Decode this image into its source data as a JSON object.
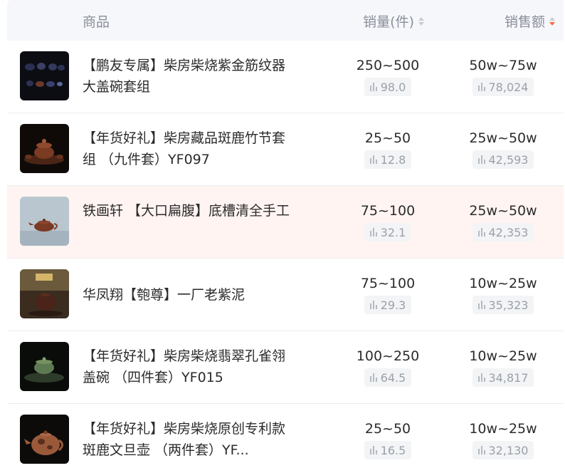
{
  "header": {
    "product": "商品",
    "sales_volume": "销量(件)",
    "sales_amount": "销售额"
  },
  "rows": [
    {
      "name": "【鹏友专属】柴房柴烧紫金筋纹器大盖碗套组",
      "sales_range": "250~500",
      "sales_index": "98.0",
      "amount_range": "50w~75w",
      "amount_index": "78,024",
      "highlight": false
    },
    {
      "name": "【年货好礼】柴房藏品斑鹿竹节套组 （九件套）YF097",
      "sales_range": "25~50",
      "sales_index": "12.8",
      "amount_range": "25w~50w",
      "amount_index": "42,593",
      "highlight": false
    },
    {
      "name": "铁画轩 【大口扁腹】底槽清全手工",
      "sales_range": "75~100",
      "sales_index": "32.1",
      "amount_range": "25w~50w",
      "amount_index": "42,353",
      "highlight": true
    },
    {
      "name": "华凤翔【匏尊】一厂老紫泥",
      "sales_range": "75~100",
      "sales_index": "29.3",
      "amount_range": "10w~25w",
      "amount_index": "35,323",
      "highlight": false
    },
    {
      "name": "【年货好礼】柴房柴烧翡翠孔雀翎盖碗 （四件套）YF015",
      "sales_range": "100~250",
      "sales_index": "64.5",
      "amount_range": "10w~25w",
      "amount_index": "34,817",
      "highlight": false
    },
    {
      "name": "【年货好礼】柴房柴烧原创专利款斑鹿文旦壶 （两件套）YF...",
      "sales_range": "25~50",
      "sales_index": "16.5",
      "amount_range": "10w~25w",
      "amount_index": "32,130",
      "highlight": false
    }
  ],
  "colors": {
    "sort_active": "#ff6a3d",
    "header_bg": "#f6f7fa",
    "highlight_bg": "#fff4f2"
  }
}
